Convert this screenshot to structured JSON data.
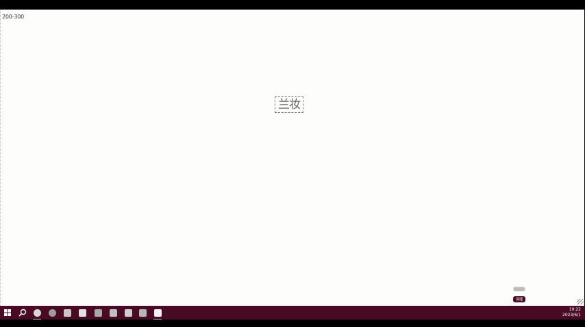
{
  "canvas": {
    "coord_readout": "200-300",
    "selected_text": "兰妆"
  },
  "floating": {
    "badge_label": "清理"
  },
  "taskbar": {
    "accent_color": "#4a0a24",
    "apps": [
      {
        "name": "edge",
        "icon": "edge-icon",
        "color": "#d8d8d8"
      },
      {
        "name": "chrome",
        "icon": "chrome-icon",
        "color": "#9c9c9c"
      },
      {
        "name": "settings",
        "icon": "settings-icon",
        "color": "#c8c8c8"
      },
      {
        "name": "files",
        "icon": "file-icon",
        "color": "#e0e0e0"
      },
      {
        "name": "media",
        "icon": "film-icon",
        "color": "#a7a7a7"
      },
      {
        "name": "code",
        "icon": "code-icon",
        "color": "#bfbfbf"
      },
      {
        "name": "keyboard",
        "icon": "keyboard-icon",
        "color": "#cfcfcf"
      },
      {
        "name": "tools",
        "icon": "tools-icon",
        "color": "#b5b5b5"
      },
      {
        "name": "text",
        "icon": "text-icon",
        "color": "#f2f2f2"
      }
    ],
    "clock_time": "19:22",
    "clock_date": "2023/6/1"
  }
}
